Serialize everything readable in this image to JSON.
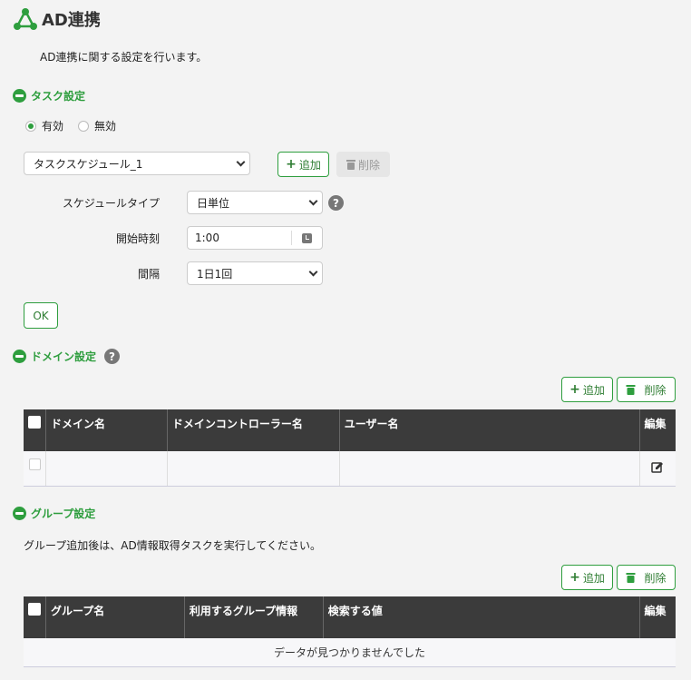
{
  "header": {
    "title": "AD連携",
    "description": "AD連携に関する設定を行います。"
  },
  "task": {
    "section_label": "タスク設定",
    "radio_enabled": "有効",
    "radio_disabled": "無効",
    "selected_radio": "有効",
    "schedule_select": "タスクスケジュール_1",
    "add_label": "追加",
    "delete_label": "削除",
    "schedule_type_label": "スケジュールタイプ",
    "schedule_type_value": "日単位",
    "start_time_label": "開始時刻",
    "start_time_value": "1:00",
    "interval_label": "間隔",
    "interval_value": "1日1回",
    "ok_label": "OK"
  },
  "domain": {
    "section_label": "ドメイン設定",
    "add_label": "追加",
    "delete_label": "削除",
    "columns": [
      "ドメイン名",
      "ドメインコントローラー名",
      "ユーザー名",
      "編集"
    ],
    "rows": [
      [
        "",
        "",
        ""
      ]
    ]
  },
  "group": {
    "section_label": "グループ設定",
    "note": "グループ追加後は、AD情報取得タスクを実行してください。",
    "add_label": "追加",
    "delete_label": "削除",
    "columns": [
      "グループ名",
      "利用するグループ情報",
      "検索する値",
      "編集"
    ],
    "empty_message": "データが見つかりませんでした"
  },
  "icons": {
    "logo": "network-triangle-icon",
    "collapse": "minus-circle-icon",
    "help": "question-circle-icon",
    "clock": "clock-icon",
    "trash": "trash-icon",
    "edit": "pencil-edit-icon",
    "chevron": "chevron-down-icon"
  },
  "colors": {
    "accent": "#2e9e3e",
    "table_header": "#3b3b3b",
    "background": "#f3f3f3"
  }
}
